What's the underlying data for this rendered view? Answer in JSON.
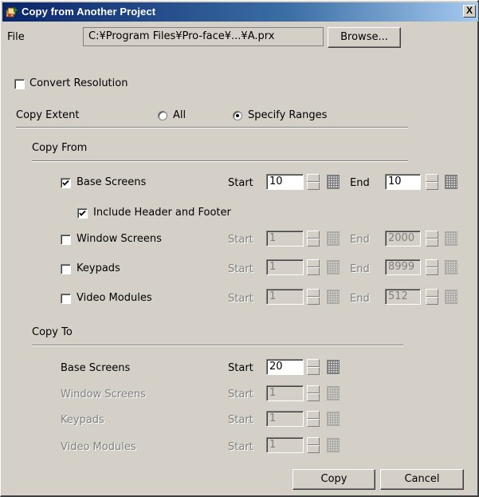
{
  "window": {
    "title": "Copy from Another Project",
    "close_glyph": "X"
  },
  "file": {
    "label": "File",
    "path": "C:¥Program Files¥Pro-face¥...¥A.prx",
    "browse_label": "Browse..."
  },
  "convert_resolution": {
    "label": "Convert Resolution",
    "checked": false
  },
  "copy_extent": {
    "label": "Copy Extent",
    "options": [
      {
        "label": "All",
        "selected": false
      },
      {
        "label": "Specify Ranges",
        "selected": true
      }
    ]
  },
  "copy_from": {
    "heading": "Copy From",
    "start_label": "Start",
    "end_label": "End",
    "rows": [
      {
        "label": "Base Screens",
        "checked": true,
        "enabled": true,
        "start": "10",
        "end": "10"
      },
      {
        "label": "Window Screens",
        "checked": false,
        "enabled": false,
        "start": "1",
        "end": "2000"
      },
      {
        "label": "Keypads",
        "checked": false,
        "enabled": false,
        "start": "1",
        "end": "8999"
      },
      {
        "label": "Video Modules",
        "checked": false,
        "enabled": false,
        "start": "1",
        "end": "512"
      }
    ],
    "include_header_footer": {
      "label": "Include Header and Footer",
      "checked": true
    }
  },
  "copy_to": {
    "heading": "Copy To",
    "start_label": "Start",
    "rows": [
      {
        "label": "Base Screens",
        "enabled": true,
        "start": "20"
      },
      {
        "label": "Window Screens",
        "enabled": false,
        "start": "1"
      },
      {
        "label": "Keypads",
        "enabled": false,
        "start": "1"
      },
      {
        "label": "Video Modules",
        "enabled": false,
        "start": "1"
      }
    ]
  },
  "buttons": {
    "copy": "Copy",
    "cancel": "Cancel"
  },
  "colors": {
    "face": "#d4d0c8",
    "title_start": "#0a246a",
    "title_end": "#a6caf0",
    "disabled_text": "#808080"
  }
}
